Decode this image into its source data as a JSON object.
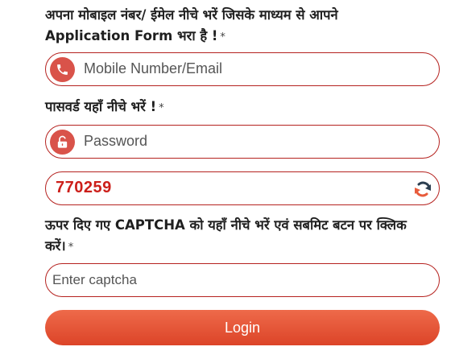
{
  "login_form": {
    "mobile_label_line1": "अपना मोबाइल नंबर/ ईमेल नीचे भरें जिसके माध्यम से आपने",
    "mobile_label_line2": "Application Form भरा है !",
    "required_mark": "*",
    "mobile_placeholder": "Mobile Number/Email",
    "password_label": "पासवर्ड यहाँ नीचे भरें !",
    "password_placeholder": "Password",
    "captcha_code": "770259",
    "captcha_label_line1": "ऊपर दिए गए CAPTCHA को यहाँ नीचे भरें एवं सबमिट बटन पर क्लिक",
    "captcha_label_line2": "करें।",
    "captcha_placeholder": "Enter captcha",
    "login_button": "Login"
  },
  "icons": {
    "mobile_field": "phone-icon",
    "password_field": "unlock-icon",
    "captcha_refresh": "refresh-icon"
  },
  "colors": {
    "accent": "#b5221f",
    "icon_bg": "#d9534a",
    "captcha_text": "#cc1f1a",
    "button_gradient_top": "#ee6a4a",
    "button_gradient_bottom": "#dc4428"
  }
}
